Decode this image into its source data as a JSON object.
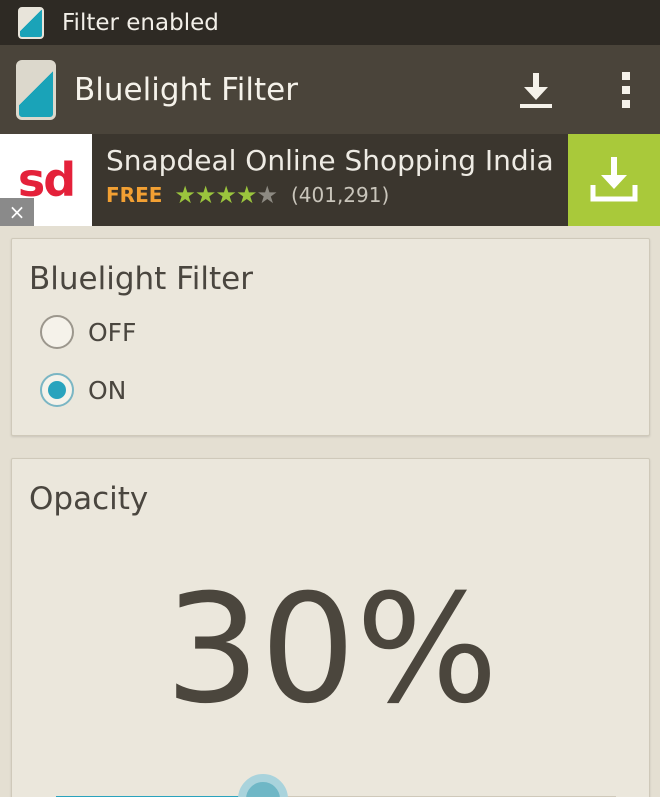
{
  "status_bar": {
    "notification_icon": "phone-screen-icon",
    "text": "Filter enabled"
  },
  "action_bar": {
    "app_icon": "phone-screen-icon",
    "title": "Bluelight Filter",
    "download_icon": "download-icon",
    "overflow_icon": "overflow-menu-icon"
  },
  "ad": {
    "logo_text": "sd",
    "close_label": "×",
    "title": "Snapdeal Online Shopping India",
    "price": "FREE",
    "stars_full": "★★★★",
    "stars_empty": "★",
    "rating": 4,
    "review_count": "(401,291)",
    "install_icon": "download-icon",
    "colors": {
      "logo": "#e4213a",
      "install_bg": "#a9c93a",
      "free": "#f2a033",
      "stars": "#9bc53d"
    }
  },
  "filter_card": {
    "title": "Bluelight Filter",
    "options": [
      {
        "label": "OFF",
        "checked": false
      },
      {
        "label": "ON",
        "checked": true
      }
    ]
  },
  "opacity_card": {
    "title": "Opacity",
    "value_text": "30%",
    "slider_value": 0.37
  },
  "colors": {
    "accent": "#2aa3bd",
    "background": "#e4dfd2",
    "action_bar": "#4a443a"
  }
}
